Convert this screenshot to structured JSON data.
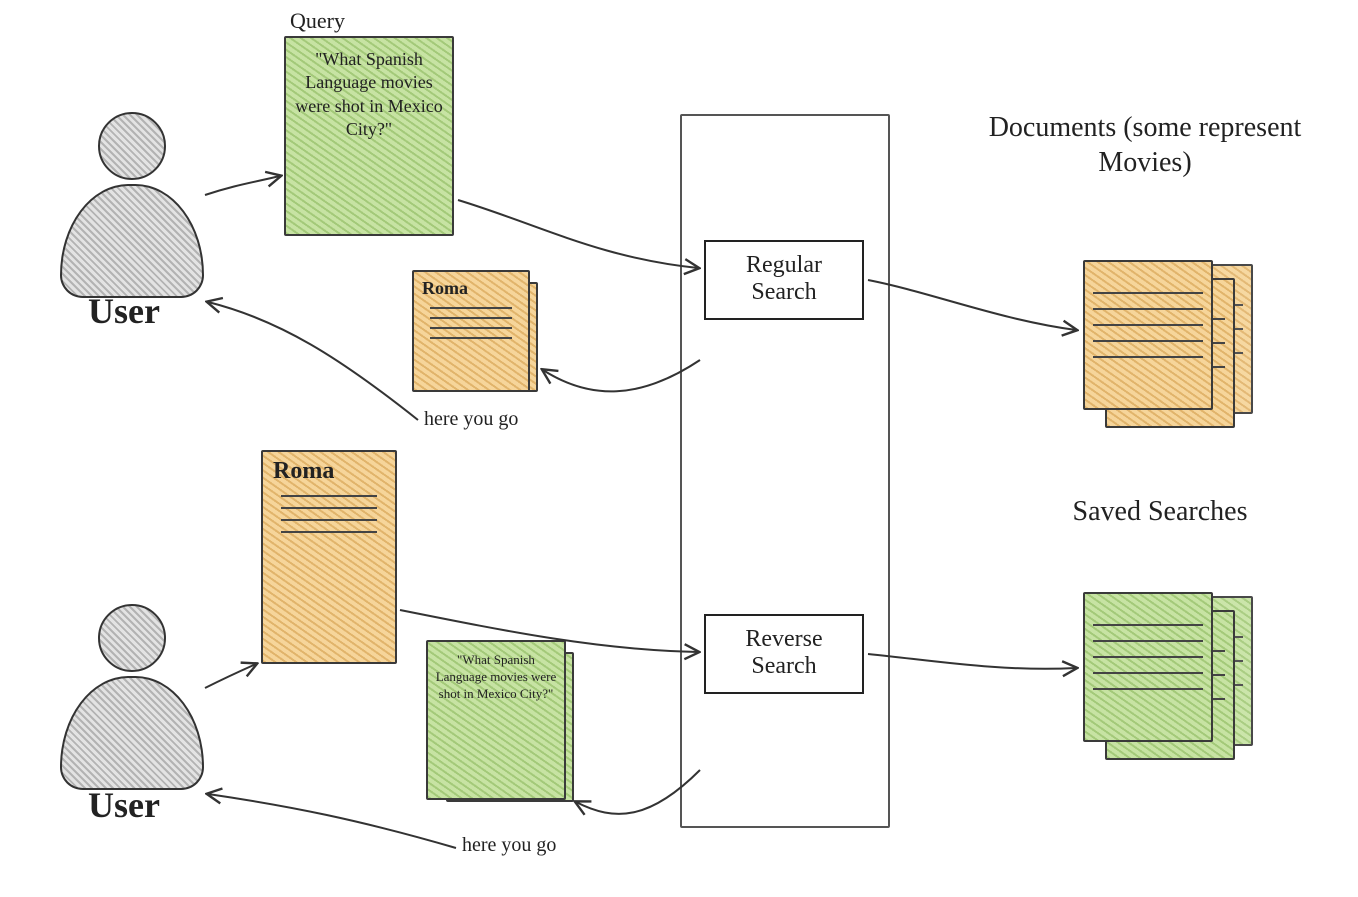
{
  "diagram": {
    "users": {
      "top_label": "User",
      "bottom_label": "User"
    },
    "query_card": {
      "label": "Query",
      "text": "\"What Spanish Language movies were shot in Mexico City?\""
    },
    "roma_small_title": "Roma",
    "roma_large_title": "Roma",
    "result_card_text": "\"What Spanish Language movies were shot in Mexico City?\"",
    "system": {
      "regular_label": "Regular Search",
      "reverse_label": "Reverse Search"
    },
    "headings": {
      "documents": "Documents (some represent Movies)",
      "saved_searches": "Saved Searches"
    },
    "arrows": {
      "here_you_go_top": "here you go",
      "here_you_go_bottom": "here you go"
    }
  }
}
